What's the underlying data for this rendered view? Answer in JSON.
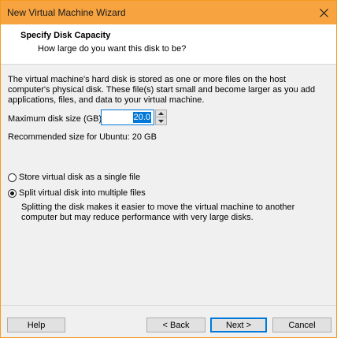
{
  "window": {
    "title": "New Virtual Machine Wizard"
  },
  "header": {
    "title": "Specify Disk Capacity",
    "subtitle": "How large do you want this disk to be?"
  },
  "content": {
    "description": "The virtual machine's hard disk is stored as one or more files on the host computer's physical disk. These file(s) start small and become larger as you add applications, files, and data to your virtual machine.",
    "max_size_label": "Maximum disk size (GB):",
    "max_size_value": "20.0",
    "recommended": "Recommended size for Ubuntu: 20 GB",
    "options": [
      {
        "label": "Store virtual disk as a single file",
        "checked": false
      },
      {
        "label": "Split virtual disk into multiple files",
        "checked": true
      }
    ],
    "split_description": "Splitting the disk makes it easier to move the virtual machine to another computer but may reduce performance with very large disks."
  },
  "buttons": {
    "help": "Help",
    "back": "< Back",
    "next": "Next >",
    "cancel": "Cancel"
  },
  "colors": {
    "title_bar": "#f6a340",
    "accent": "#0078d7"
  }
}
